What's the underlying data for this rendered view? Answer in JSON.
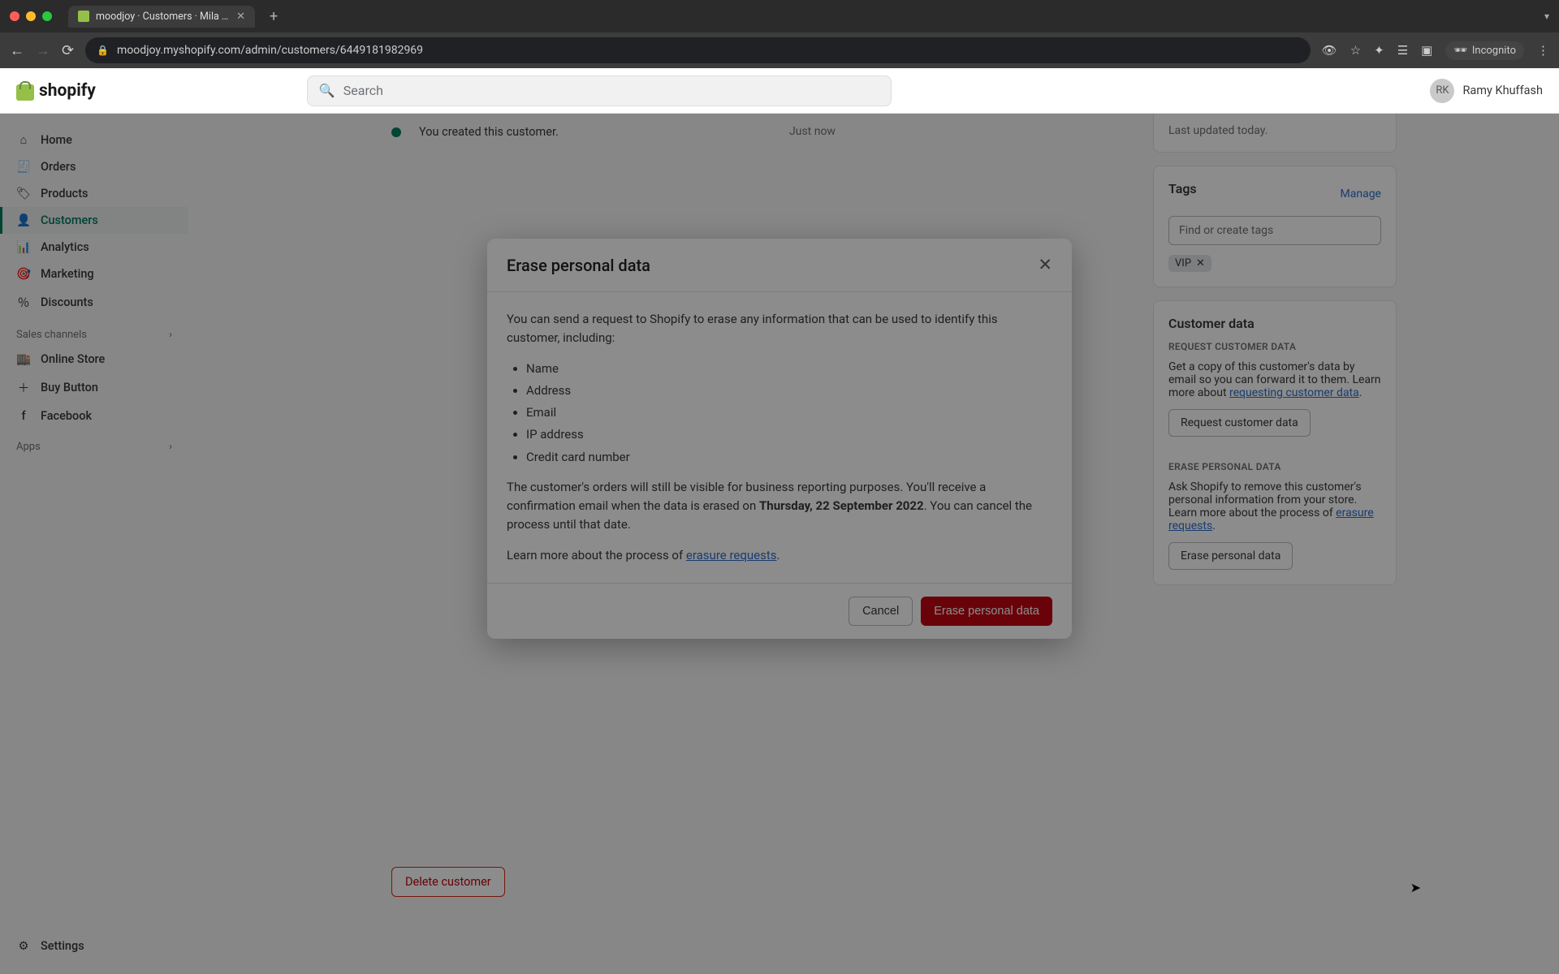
{
  "browser": {
    "tab_title": "moodjoy · Customers · Mila Jo…",
    "url": "moodjoy.myshopify.com/admin/customers/6449181982969",
    "incognito_label": "Incognito"
  },
  "header": {
    "logo_text": "shopify",
    "search_placeholder": "Search",
    "user_initials": "RK",
    "user_name": "Ramy Khuffash"
  },
  "sidebar": {
    "items": [
      {
        "label": "Home"
      },
      {
        "label": "Orders"
      },
      {
        "label": "Products"
      },
      {
        "label": "Customers"
      },
      {
        "label": "Analytics"
      },
      {
        "label": "Marketing"
      },
      {
        "label": "Discounts"
      }
    ],
    "channels_heading": "Sales channels",
    "channels": [
      {
        "label": "Online Store"
      },
      {
        "label": "Buy Button"
      },
      {
        "label": "Facebook"
      }
    ],
    "apps_heading": "Apps",
    "settings_label": "Settings"
  },
  "timeline": {
    "event": "You created this customer.",
    "time": "Just now"
  },
  "right": {
    "last_updated": "Last updated today.",
    "tags_heading": "Tags",
    "manage_label": "Manage",
    "tag_placeholder": "Find or create tags",
    "tag_value": "VIP",
    "customer_data_heading": "Customer data",
    "request_heading": "REQUEST CUSTOMER DATA",
    "request_text_1": "Get a copy of this customer's data by email so you can forward it to them. Learn more about ",
    "request_link": "requesting customer data",
    "request_period": ".",
    "request_button": "Request customer data",
    "erase_heading": "ERASE PERSONAL DATA",
    "erase_text_1": "Ask Shopify to remove this customer's personal information from your store. Learn more about the process of ",
    "erase_link": "erasure requests",
    "erase_period": ".",
    "erase_button": "Erase personal data"
  },
  "delete_button": "Delete customer",
  "modal": {
    "title": "Erase personal data",
    "intro": "You can send a request to Shopify to erase any information that can be used to identify this customer, including:",
    "items": [
      "Name",
      "Address",
      "Email",
      "IP address",
      "Credit card number"
    ],
    "para2_a": "The customer's orders will still be visible for business reporting purposes. You'll receive a confirmation email when the data is erased on ",
    "para2_date": "Thursday, 22 September 2022",
    "para2_b": ". You can cancel the process until that date.",
    "para3_a": "Learn more about the process of ",
    "para3_link": "erasure requests",
    "para3_b": ".",
    "cancel": "Cancel",
    "confirm": "Erase personal data"
  }
}
